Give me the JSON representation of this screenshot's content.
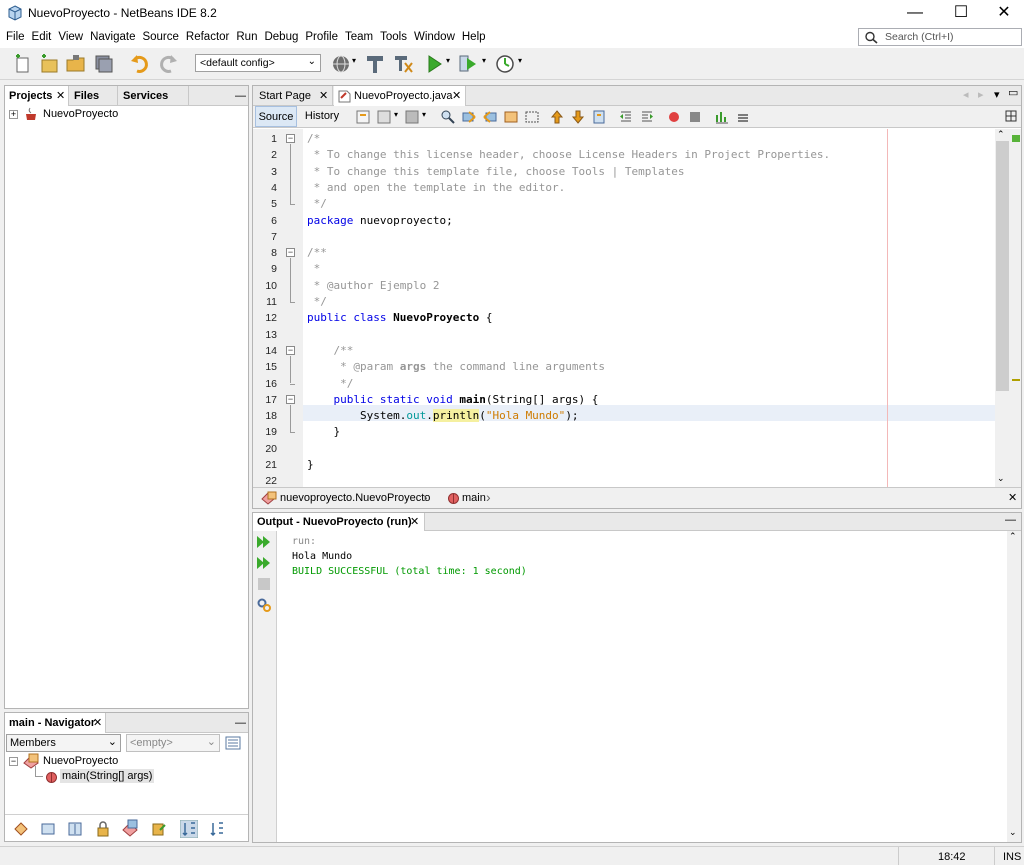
{
  "window": {
    "title": "NuevoProyecto - NetBeans IDE 8.2",
    "minimize": "—",
    "maximize": "☐",
    "close": "✕"
  },
  "menu": [
    "File",
    "Edit",
    "View",
    "Navigate",
    "Source",
    "Refactor",
    "Run",
    "Debug",
    "Profile",
    "Team",
    "Tools",
    "Window",
    "Help"
  ],
  "search": {
    "placeholder": "Search (Ctrl+I)"
  },
  "toolbar": {
    "config_value": "<default config>"
  },
  "projects_panel": {
    "tabs": [
      "Projects",
      "Files",
      "Services"
    ],
    "tree": [
      "NuevoProyecto"
    ]
  },
  "navigator": {
    "title": "main - Navigator",
    "filter": "Members",
    "empty": "<empty>",
    "class_name": "NuevoProyecto",
    "method": "main(String[] args)"
  },
  "editor": {
    "tabs": [
      "Start Page",
      "NuevoProyecto.java"
    ],
    "source_tab": "Source",
    "history_tab": "History",
    "breadcrumb": [
      "nuevoproyecto.NuevoProyecto",
      "main"
    ],
    "line_numbers": [
      "1",
      "2",
      "3",
      "4",
      "5",
      "6",
      "7",
      "8",
      "9",
      "10",
      "11",
      "12",
      "13",
      "14",
      "15",
      "16",
      "17",
      "18",
      "19",
      "20",
      "21",
      "22"
    ],
    "code": {
      "l1": "/*",
      "l2": " * To change this license header, choose License Headers in Project Properties.",
      "l3": " * To change this template file, choose Tools | Templates",
      "l4": " * and open the template in the editor.",
      "l5": " */",
      "l6_kw": "package",
      "l6_rest": " nuevoproyecto;",
      "l8": "/**",
      "l9": " *",
      "l10": " * @author Ejemplo 2",
      "l11": " */",
      "l12_kw": "public class",
      "l12_name": " NuevoProyecto",
      "l12_rest": " {",
      "l14": "    /**",
      "l15_a": "     * @param ",
      "l15_b": "args",
      "l15_c": " the command line arguments",
      "l16": "     */",
      "l17_kw": "    public static void",
      "l17_name": " main",
      "l17_rest": "(String[] args) {",
      "l18_a": "        System.",
      "l18_out": "out",
      "l18_dot": ".",
      "l18_m": "println",
      "l18_p1": "(",
      "l18_str": "\"Hola Mundo\"",
      "l18_p2": ");",
      "l19": "    }",
      "l21": "}"
    }
  },
  "output": {
    "title": "Output - NuevoProyecto (run)",
    "lines": [
      "run:",
      "Hola Mundo",
      "BUILD SUCCESSFUL (total time: 1 second)"
    ]
  },
  "status": {
    "time": "18:42",
    "mode": "INS"
  },
  "colors": {
    "keyword": "#0000e6",
    "comment": "#969696",
    "string": "#ce7b00",
    "success": "#009900"
  }
}
